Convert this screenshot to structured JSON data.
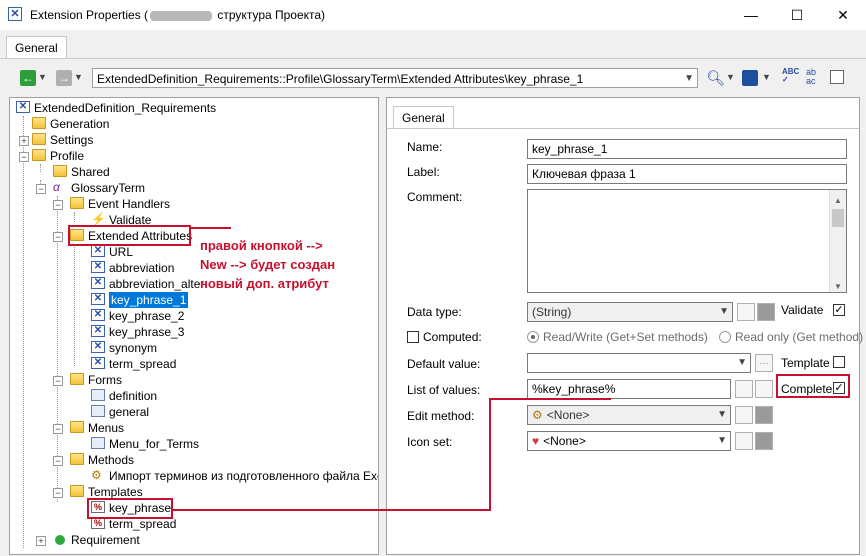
{
  "window": {
    "title_prefix": "Extension Properties (",
    "title_suffix": " структура Проекта)",
    "minimize": "—",
    "maximize": "☐",
    "close": "✕"
  },
  "outer_tab": "General",
  "toolbar": {
    "path": "ExtendedDefinition_Requirements::Profile\\GlossaryTerm\\Extended Attributes\\key_phrase_1"
  },
  "tree": {
    "root": "ExtendedDefinition_Requirements",
    "generation": "Generation",
    "settings": "Settings",
    "profile": "Profile",
    "shared": "Shared",
    "glossary_term": "GlossaryTerm",
    "event_handlers": "Event Handlers",
    "validate": "Validate",
    "extended_attributes": "Extended Attributes",
    "attrs": [
      "URL",
      "abbreviation",
      "abbreviation_alter",
      "key_phrase_1",
      "key_phrase_2",
      "key_phrase_3",
      "synonym",
      "term_spread"
    ],
    "forms": "Forms",
    "form_items": [
      "definition",
      "general"
    ],
    "menus": "Menus",
    "menu_items": [
      "Menu_for_Terms"
    ],
    "methods": "Methods",
    "method_items": [
      "Импорт терминов  из подготовленного файла Excel"
    ],
    "templates": "Templates",
    "template_items": [
      "key_phrase",
      "term_spread"
    ],
    "requirement": "Requirement"
  },
  "annotation": {
    "line1": "правой кнопкой -->",
    "line2": "New --> будет создан",
    "line3": "новый доп. атрибут"
  },
  "panel": {
    "tab": "General",
    "name_label": "Name:",
    "name_value": "key_phrase_1",
    "label_label": "Label:",
    "label_value": "Ключевая фраза 1",
    "comment_label": "Comment:",
    "data_type_label": "Data type:",
    "data_type_value": "(String)",
    "validate_label": "Validate",
    "computed_label": "Computed:",
    "read_write": "Read/Write (Get+Set methods)",
    "read_only": "Read only (Get method)",
    "default_value_label": "Default value:",
    "default_value_value": "",
    "template_label": "Template",
    "list_of_values_label": "List of values:",
    "list_of_values_value": "%key_phrase%",
    "complete_label": "Complete",
    "edit_method_label": "Edit method:",
    "edit_method_value": "<None>",
    "icon_set_label": "Icon set:",
    "icon_set_value": "<None>"
  }
}
